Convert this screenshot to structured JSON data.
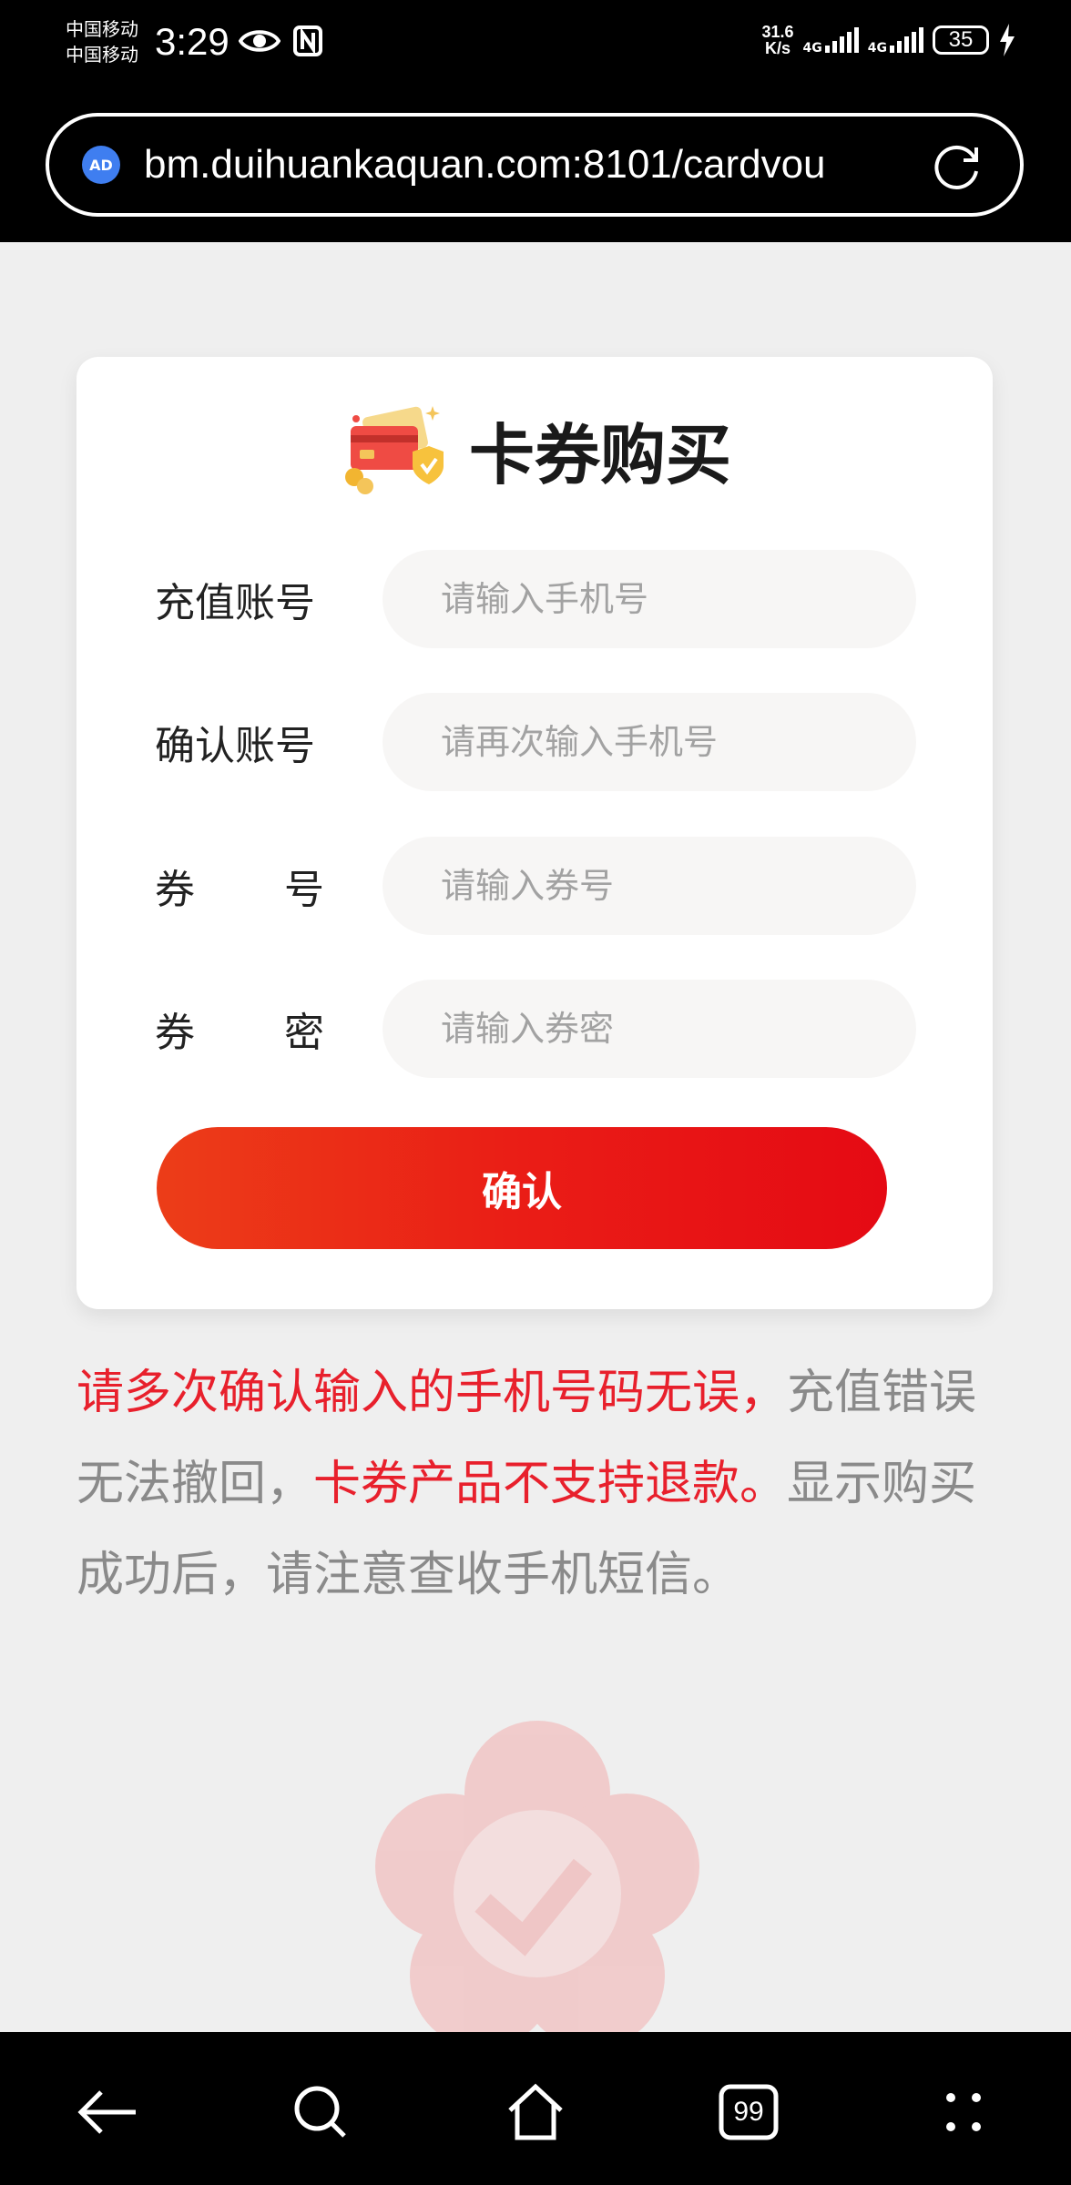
{
  "status_bar": {
    "carrier_1": "中国移动",
    "carrier_2": "中国移动",
    "time": "3:29",
    "net_speed_value": "31.6",
    "net_speed_unit": "K/s",
    "network_1": "4G",
    "network_2": "4G",
    "battery": "35"
  },
  "browser": {
    "url": "bm.duihuankaquan.com:8101/cardvou",
    "ad_badge": "AD"
  },
  "card": {
    "title": "卡券购买",
    "fields": [
      {
        "label": "充值账号",
        "placeholder": "请输入手机号"
      },
      {
        "label": "确认账号",
        "placeholder": "请再次输入手机号"
      },
      {
        "label_a": "券",
        "label_b": "号",
        "placeholder": "请输入券号"
      },
      {
        "label_a": "券",
        "label_b": "密",
        "placeholder": "请输入券密"
      }
    ],
    "confirm_label": "确认"
  },
  "notice": {
    "part1_red": "请多次确认输入的手机号码无误，",
    "part2": "充值错误无法撤回，",
    "part3_red": "卡券产品不支持退款。",
    "part4": "显示购买成功后，请注意查收手机短信。"
  },
  "nav": {
    "tabs_count": "99"
  },
  "colors": {
    "accent_red": "#e8202c",
    "button_gradient_start": "#ec3d18",
    "button_gradient_end": "#e50a14"
  }
}
